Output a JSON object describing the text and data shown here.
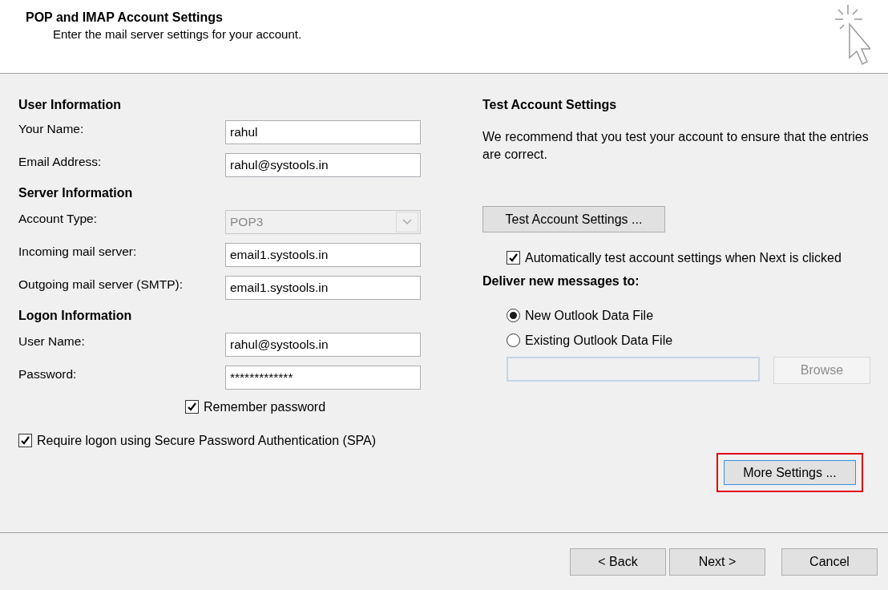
{
  "header": {
    "title": "POP and IMAP Account Settings",
    "subtitle": "Enter the mail server settings for your account."
  },
  "sections": [
    {
      "heading": "User Information",
      "fields": [
        {
          "label": "Your Name:",
          "value": "rahul",
          "kind": "text"
        },
        {
          "label": "Email Address:",
          "value": "rahul@systools.in",
          "kind": "text"
        }
      ]
    },
    {
      "heading": "Server Information",
      "fields": [
        {
          "label": "Account Type:",
          "value": "POP3",
          "kind": "dropdown",
          "disabled": true
        },
        {
          "label": "Incoming mail server:",
          "value": "email1.systools.in",
          "kind": "text"
        },
        {
          "label": "Outgoing mail server (SMTP):",
          "value": "email1.systools.in",
          "kind": "text"
        }
      ]
    },
    {
      "heading": "Logon Information",
      "fields": [
        {
          "label": "User Name:",
          "value": "rahul@systools.in",
          "kind": "text"
        },
        {
          "label": "Password:",
          "value": "*************",
          "kind": "text"
        }
      ]
    }
  ],
  "remember_password": {
    "label": "Remember password",
    "checked": true
  },
  "spa": {
    "label": "Require logon using Secure Password Authentication (SPA)",
    "checked": true
  },
  "test": {
    "heading": "Test Account Settings",
    "description": "We recommend that you test your account to ensure that the entries are correct.",
    "button": "Test Account Settings ...",
    "auto_test": {
      "label": "Automatically test account settings when Next is clicked",
      "checked": true
    }
  },
  "deliver": {
    "heading": "Deliver new messages to:",
    "options": [
      {
        "label": "New Outlook Data File",
        "selected": true
      },
      {
        "label": "Existing Outlook Data File",
        "selected": false
      }
    ],
    "browse": {
      "label": "Browse",
      "disabled": true
    }
  },
  "more_settings": {
    "label": "More Settings ...",
    "highlighted": true
  },
  "footer_buttons": [
    {
      "label": "< Back"
    },
    {
      "label": "Next >"
    },
    {
      "label": "Cancel"
    }
  ]
}
